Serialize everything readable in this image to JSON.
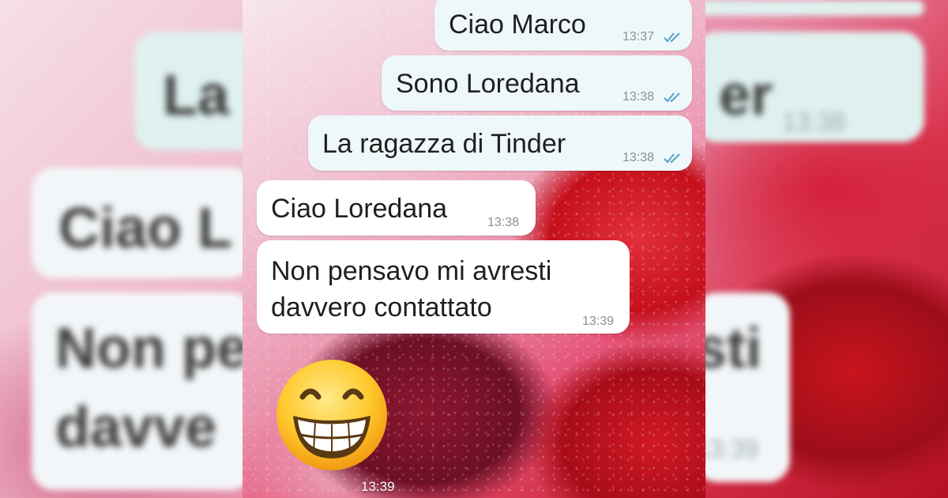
{
  "messages": [
    {
      "id": "m1",
      "direction": "outgoing",
      "text": "Ciao Marco",
      "time": "13:37",
      "status": "read"
    },
    {
      "id": "m2",
      "direction": "outgoing",
      "text": "Sono Loredana",
      "time": "13:38",
      "status": "read"
    },
    {
      "id": "m3",
      "direction": "outgoing",
      "text": "La ragazza di Tinder",
      "time": "13:38",
      "status": "read"
    },
    {
      "id": "m4",
      "direction": "incoming",
      "text": "Ciao Loredana",
      "time": "13:38"
    },
    {
      "id": "m5",
      "direction": "incoming",
      "text_lines": [
        "Non pensavo mi avresti",
        "davvero contattato"
      ],
      "time": "13:39"
    },
    {
      "id": "m6",
      "direction": "incoming",
      "emoji": "grinning-face-with-smiling-eyes",
      "time": "13:39"
    }
  ],
  "blurred_background": {
    "left_fragments": [
      "La",
      "Ciao L",
      "Non pe",
      "davve"
    ],
    "right_fragments": [
      "er",
      "13:38",
      "sti",
      "13:39"
    ]
  },
  "colors": {
    "outgoing_bubble": "#eef7f9",
    "incoming_bubble": "#ffffff",
    "read_ticks": "#4fa3c7",
    "time_text": "#8a8f93"
  },
  "icons": {
    "read_status": "double-check-icon",
    "emoji": "grinning-face-emoji"
  }
}
